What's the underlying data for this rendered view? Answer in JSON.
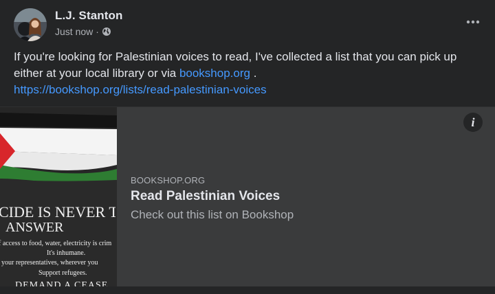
{
  "post": {
    "author": "L.J. Stanton",
    "timestamp": "Just now",
    "separator": "·",
    "privacy_icon": "globe-icon",
    "more_icon": "more-options-icon"
  },
  "body": {
    "text_before": "If you're looking for Palestinian voices to read, I've collected a list that you can pick up either at your local library or via ",
    "inline_link": "bookshop.org",
    "text_after": " .",
    "url_link": "https://bookshop.org/lists/read-palestinian-voices"
  },
  "preview": {
    "domain": "BOOKSHOP.ORG",
    "title": "Read Palestinian Voices",
    "description": "Check out this list on Bookshop",
    "info_label": "i",
    "thumbnail": {
      "line1": "CIDE IS NEVER T",
      "line2": "ANSWER",
      "line3": "f access to food, water, electricity is crim",
      "line4": "It's inhumane.",
      "line5": "your representatives, wherever you",
      "line6": "Support refugees.",
      "line7": "DEMAND A CEASE"
    }
  },
  "colors": {
    "background": "#242526",
    "card": "#3a3b3c",
    "link": "#4599ff",
    "text_primary": "#e4e6eb",
    "text_secondary": "#b0b3b8",
    "flag_red": "#d8262b",
    "flag_green": "#2e7d32",
    "flag_black": "#111111"
  }
}
